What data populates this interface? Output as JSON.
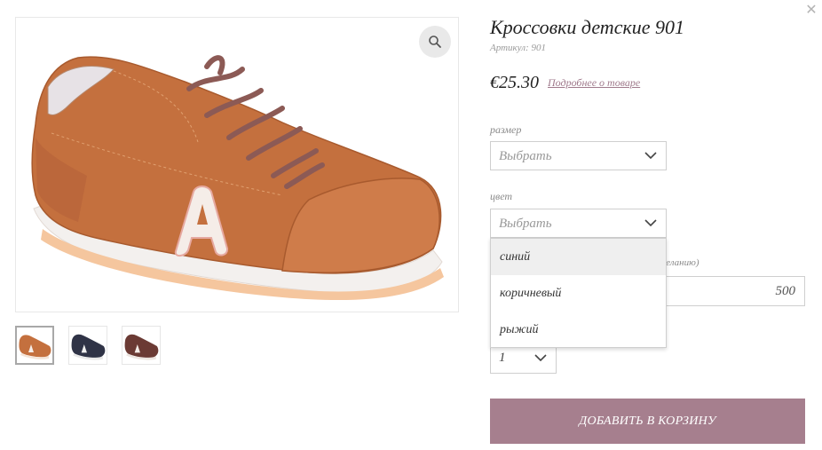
{
  "product": {
    "title": "Кроссовки детские 901",
    "sku": "Артикул: 901",
    "price": "€25.30",
    "details_link": "Подробнее о товаре"
  },
  "gallery": {
    "zoom_icon": "magnifier-icon",
    "thumbnails": [
      {
        "color_name": "orange",
        "shoe_color": "#c4703e",
        "active": true
      },
      {
        "color_name": "navy",
        "shoe_color": "#2f3346",
        "active": false
      },
      {
        "color_name": "brown",
        "shoe_color": "#6b3a34",
        "active": false
      }
    ]
  },
  "options": {
    "size": {
      "label": "размер",
      "value": "Выбрать"
    },
    "color": {
      "label": "цвет",
      "value": "Выбрать",
      "dropdown": [
        "синий",
        "коричневый",
        "рыжий"
      ],
      "highlighted": "синий"
    },
    "partial_label": "желанию)",
    "amount": "500",
    "quantity": "1"
  },
  "add_to_cart": "ДОБАВИТЬ В КОРЗИНУ",
  "close_icon": "close-icon",
  "colors": {
    "accent": "#a67f8e",
    "link": "#a07a8c",
    "shoe_main": "#c4703e"
  }
}
